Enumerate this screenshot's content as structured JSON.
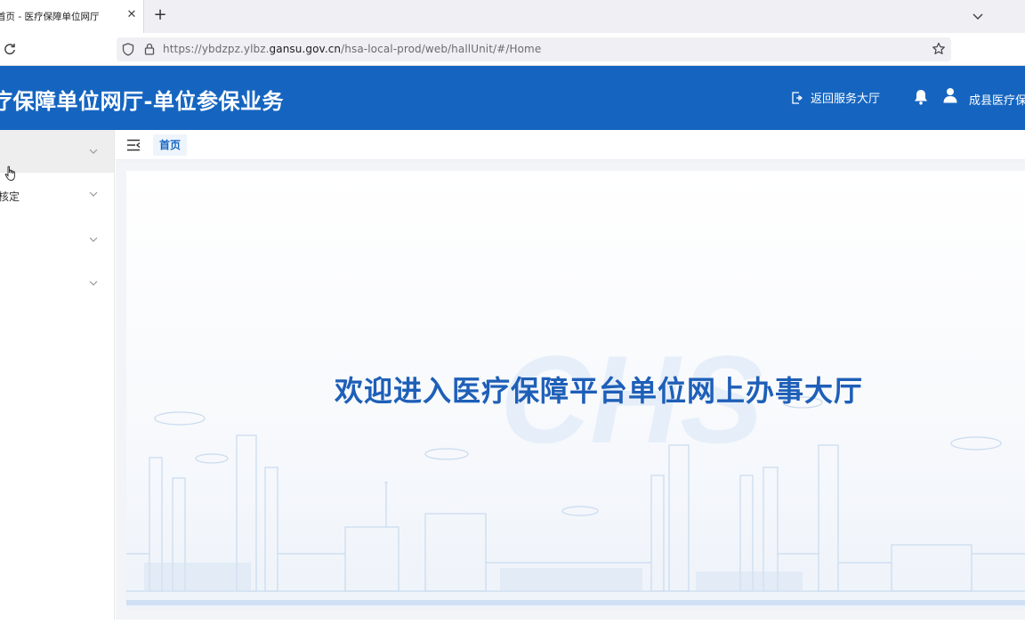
{
  "browser": {
    "tab_title": "首页 - 医疗保障单位网厅",
    "tab_close_glyph": "✕",
    "new_tab_glyph": "+",
    "url_prefix": "https://ybdzpz.ylbz.",
    "url_host": "gansu.gov.cn",
    "url_path": "/hsa-local-prod/web/hallUnit/#/Home"
  },
  "header": {
    "title": "疗保障单位网厅-单位参保业务",
    "back_link": "返回服务大厅",
    "user_name": "成县医疗保障",
    "bg_color": "#1565c0"
  },
  "sidebar": {
    "items": [
      {
        "label": ""
      },
      {
        "label": "核定"
      },
      {
        "label": ""
      },
      {
        "label": ""
      }
    ]
  },
  "breadcrumb": {
    "home": "首页"
  },
  "main": {
    "welcome_text": "欢迎进入医疗保障平台单位网上办事大厅",
    "watermark": "CHS",
    "accent_color": "#1e5fb8"
  }
}
